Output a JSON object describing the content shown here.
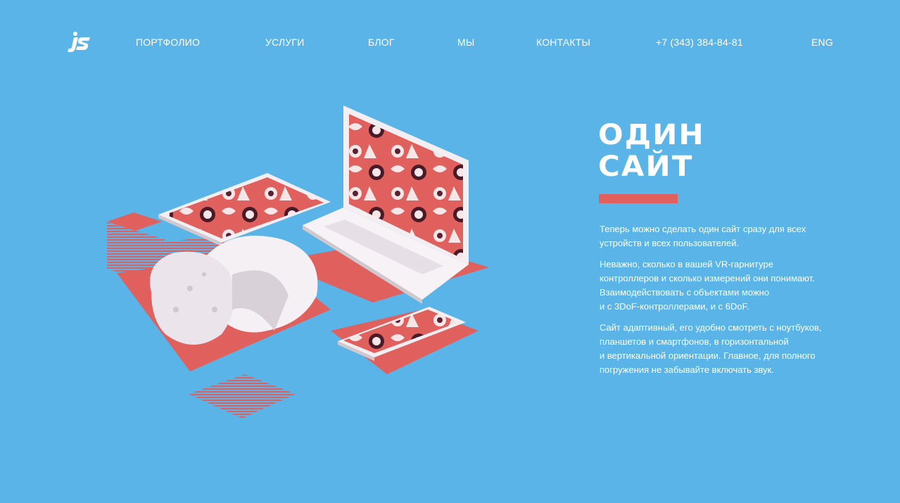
{
  "brand": {
    "logo_text": "JS",
    "logo_icon": "js-logo-icon"
  },
  "nav": {
    "portfolio": "ПОРТФОЛИО",
    "services": "УСЛУГИ",
    "blog": "БЛОГ",
    "about": "МЫ",
    "contacts": "КОНТАКТЫ",
    "phone": "+7 (343) 384-84-81",
    "language": "ENG"
  },
  "hero": {
    "title_line1": "ОДИН",
    "title_line2": "САЙТ",
    "paragraphs": [
      "Теперь можно сделать один сайт сразу для всех\nустройств и всех пользователей.",
      "Неважно, сколько в вашей VR-гарнитуре\nконтроллеров и сколько измерений они понимают.\nВзаимодействовать с объектами можно\nи с 3DoF-контроллерами, и с 6DoF.",
      "Сайт адаптивный, его удобно смотреть с ноутбуков,\nпланшетов и смартфонов, в горизонтальной\nи вертикальной ориентации. Главное, для полного\nпогружения не забывайте включать звук."
    ]
  },
  "colors": {
    "background": "#5ab4e8",
    "accent": "#e0605e",
    "text": "#ffffff",
    "device": "#f2eef2"
  }
}
